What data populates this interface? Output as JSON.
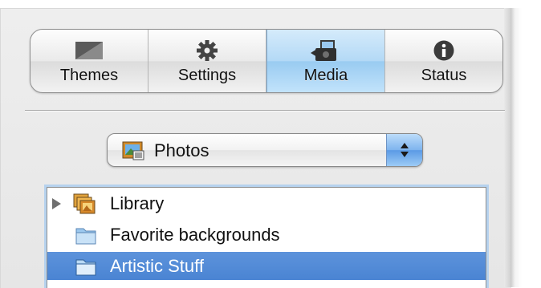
{
  "tabs": [
    {
      "label": "Themes",
      "icon": "themes-icon",
      "active": false
    },
    {
      "label": "Settings",
      "icon": "gear-icon",
      "active": false
    },
    {
      "label": "Media",
      "icon": "media-icon",
      "active": true
    },
    {
      "label": "Status",
      "icon": "info-icon",
      "active": false
    }
  ],
  "source_popup": {
    "selected": "Photos",
    "icon": "photos-icon"
  },
  "source_list": {
    "items": [
      {
        "label": "Library",
        "icon": "photo-library-icon",
        "expandable": true,
        "selected": false
      },
      {
        "label": "Favorite backgrounds",
        "icon": "folder-icon",
        "expandable": false,
        "selected": false
      },
      {
        "label": "Artistic Stuff",
        "icon": "folder-icon",
        "expandable": false,
        "selected": true
      }
    ]
  },
  "colors": {
    "selection": "#4a84d3",
    "active_tab": "#a9d3f4",
    "focus_ring": "#b6d2ee"
  }
}
